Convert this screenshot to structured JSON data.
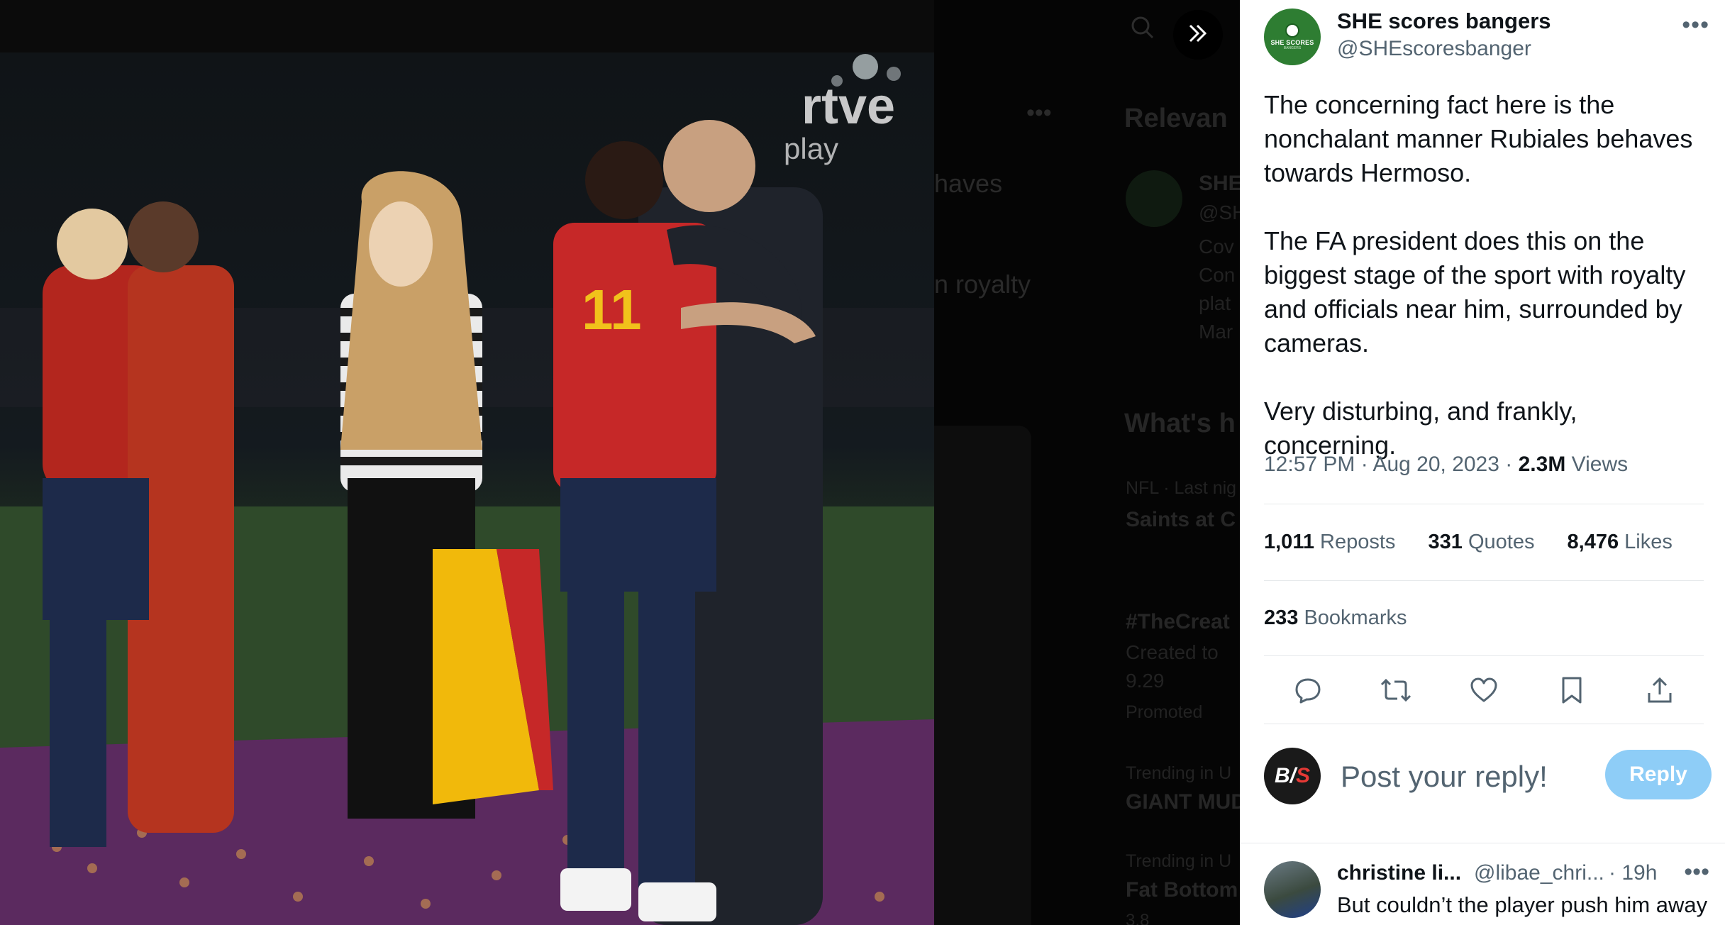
{
  "photo": {
    "watermark_main": "rtve",
    "watermark_sub": "play",
    "jersey_number": "11"
  },
  "background": {
    "text_fragments": [
      "haves",
      "n royalty"
    ],
    "relevant_header": "Relevan",
    "relevant_name": "SHE",
    "relevant_handle": "@SH",
    "relevant_lines": [
      "Cov",
      "Con",
      "plat",
      "Mar"
    ],
    "whats_header": "What's h",
    "trend_items": [
      {
        "meta": "NFL · Last nig",
        "title": "Saints at C"
      },
      {
        "meta": "",
        "title": "#TheCreat"
      },
      {
        "meta": "Created to",
        "title": ""
      },
      {
        "meta": "9.29",
        "title": ""
      },
      {
        "meta": "Promoted",
        "title": ""
      },
      {
        "meta": "Trending in U",
        "title": "GIANT MUD"
      },
      {
        "meta": "Trending in U",
        "title": "Fat Bottom"
      },
      {
        "meta": "3.8",
        "title": ""
      }
    ]
  },
  "tweet": {
    "author_name": "SHE scores bangers",
    "author_handle": "@SHEscoresbanger",
    "avatar_text_top": "SHE SCORES",
    "avatar_text_bottom": "BANGERS",
    "paragraphs": [
      "The concerning fact here is the nonchalant manner Rubiales behaves towards Hermoso.",
      "The FA president does this on the biggest stage of the sport with royalty and officials near him, surrounded by cameras.",
      "Very disturbing, and frankly, concerning."
    ],
    "time": "12:57 PM",
    "date": "Aug 20, 2023",
    "views_count": "2.3M",
    "views_label": "Views",
    "reposts_count": "1,011",
    "reposts_label": "Reposts",
    "quotes_count": "331",
    "quotes_label": "Quotes",
    "likes_count": "8,476",
    "likes_label": "Likes",
    "bookmarks_count": "233",
    "bookmarks_label": "Bookmarks"
  },
  "composer": {
    "avatar_b": "B",
    "avatar_slash": "/",
    "avatar_s": "S",
    "placeholder": "Post your reply!",
    "button_label": "Reply"
  },
  "first_reply": {
    "name": "christine li...",
    "handle": "@libae_chri...",
    "time": "· 19h",
    "text": "But couldn’t the player push him away"
  },
  "icons": [
    "search-icon",
    "expand-icon",
    "more-icon",
    "reply-icon",
    "repost-icon",
    "like-icon",
    "bookmark-icon",
    "share-icon"
  ],
  "colors": {
    "reply_button": "#8ecdf7",
    "secondary_text": "#536471",
    "primary_text": "#0f1419",
    "jersey_red": "#c62828"
  }
}
